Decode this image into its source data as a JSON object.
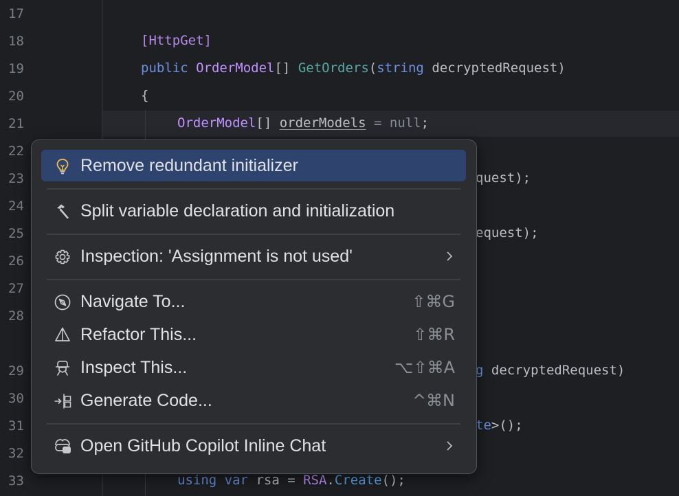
{
  "editor": {
    "line_numbers": [
      "17",
      "18",
      "19",
      "20",
      "21",
      "22",
      "23",
      "24",
      "25",
      "26",
      "27",
      "28",
      "29",
      "30",
      "31",
      "32",
      "33"
    ],
    "lines": {
      "l18_attr": "[HttpGet]",
      "l19_public": "public",
      "l19_type": "OrderModel",
      "l19_brackets": "[]",
      "l19_method": "GetOrders",
      "l19_paren_open": "(",
      "l19_string": "string",
      "l19_param": "decryptedRequest",
      "l19_paren_close": ")",
      "l20_brace": "{",
      "l21_type": "OrderModel",
      "l21_brackets": "[]",
      "l21_var": "orderModels",
      "l21_eq": " = ",
      "l21_null": "null",
      "l21_semi": ";",
      "l23_tail": "quest);",
      "l25_tail": "equest);",
      "l29_kw_tail": "g",
      "l29_param": "decryptedRequest)",
      "l31_kw_tail": "te",
      "l31_rest": ">();",
      "l33_using": "using",
      "l33_var": "var",
      "l33_name": "rsa",
      "l33_eq": " = ",
      "l33_rsa": "RSA",
      "l33_dot": ".",
      "l33_create": "Create",
      "l33_end": "();"
    }
  },
  "popup": {
    "items": [
      {
        "label": "Remove redundant initializer",
        "icon": "lightbulb-icon",
        "shortcut": "",
        "selected": true
      },
      {
        "label": "Split variable declaration and initialization",
        "icon": "hammer-icon",
        "shortcut": ""
      },
      {
        "label": "Inspection: 'Assignment is not used'",
        "icon": "gear-icon",
        "shortcut": "",
        "submenu": true
      },
      {
        "label": "Navigate To...",
        "icon": "compass-icon",
        "shortcut": "⇧⌘G"
      },
      {
        "label": "Refactor This...",
        "icon": "refactor-icon",
        "shortcut": "⇧⌘R"
      },
      {
        "label": "Inspect This...",
        "icon": "inspect-icon",
        "shortcut": "⌥⇧⌘A"
      },
      {
        "label": "Generate Code...",
        "icon": "generate-icon",
        "shortcut": "^⌘N"
      },
      {
        "label": "Open GitHub Copilot Inline Chat",
        "icon": "copilot-icon",
        "shortcut": "",
        "submenu": true
      }
    ]
  },
  "colors": {
    "background": "#1e1f22",
    "popup_bg": "#2b2d30",
    "selection": "#2e436e",
    "keyword": "#6b8fe0",
    "type": "#c191ff",
    "method": "#56a8a5"
  }
}
